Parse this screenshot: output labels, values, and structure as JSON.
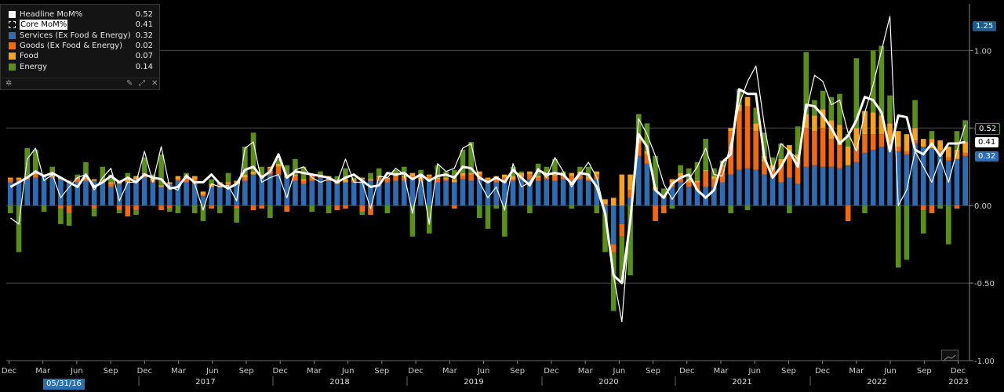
{
  "legend": {
    "items": [
      {
        "name": "Headline MoM%",
        "value": "0.52",
        "color": "#ffffff",
        "style": "filled"
      },
      {
        "name": "Core MoM%",
        "value": "0.41",
        "color": "#ffffff",
        "style": "outline"
      },
      {
        "name": "Services (Ex Food & Energy)",
        "value": "0.32",
        "color": "#2e6db4",
        "style": "filled"
      },
      {
        "name": "Goods (Ex Food & Energy)",
        "value": "0.02",
        "color": "#f26a10",
        "style": "filled"
      },
      {
        "name": "Food",
        "value": "0.07",
        "color": "#f7a21b",
        "style": "filled"
      },
      {
        "name": "Energy",
        "value": "0.14",
        "color": "#5a8f1a",
        "style": "filled"
      }
    ],
    "tools": {
      "settings_icon": "gear-icon",
      "pin_icon": "pin-icon",
      "expand_icon": "expand-icon",
      "close_icon": "close-icon"
    }
  },
  "cursor_date": "05/31/16",
  "right_tags": {
    "top": "1.25",
    "headline": "0.52",
    "core": "0.41",
    "services": "0.32"
  },
  "chart_data": {
    "type": "bar",
    "stacked": true,
    "ylim": [
      -1.0,
      1.3
    ],
    "yticks": [
      "1.00",
      "0.50",
      "0.00",
      "-0.50",
      "-1.00"
    ],
    "ytick_values": [
      1.0,
      0.5,
      0.0,
      -0.5,
      -1.0
    ],
    "x_months": [
      "Dec",
      "Mar",
      "Jun",
      "Sep",
      "Dec",
      "Mar",
      "Jun",
      "Sep",
      "Dec",
      "Mar",
      "Jun",
      "Sep",
      "Dec",
      "Mar",
      "Jun",
      "Sep",
      "Dec",
      "Mar",
      "Jun",
      "Sep",
      "Dec",
      "Mar",
      "Jun",
      "Sep",
      "Dec",
      "Mar",
      "Jun",
      "Sep",
      "Dec"
    ],
    "x_years": [
      {
        "label": "2017",
        "at": "Jun"
      },
      {
        "label": "2018",
        "at": "Jun"
      },
      {
        "label": "2019",
        "at": "Jun"
      },
      {
        "label": "2020",
        "at": "Jun"
      },
      {
        "label": "2021",
        "at": "Jun"
      },
      {
        "label": "2022",
        "at": "Jun"
      },
      {
        "label": "2023",
        "at": "Jan"
      }
    ],
    "start": "2016-02",
    "series": [
      {
        "name": "Services (Ex Food & Energy)",
        "color": "#2e6db4",
        "values": [
          0.15,
          0.16,
          0.17,
          0.18,
          0.19,
          0.18,
          0.17,
          0.16,
          0.15,
          0.16,
          0.16,
          0.15,
          0.12,
          0.14,
          0.15,
          0.17,
          0.18,
          0.15,
          0.12,
          0.14,
          0.16,
          0.15,
          0.14,
          0.06,
          0.12,
          0.12,
          0.13,
          0.14,
          0.16,
          0.2,
          0.18,
          0.2,
          0.2,
          0.18,
          0.16,
          0.14,
          0.16,
          0.18,
          0.16,
          0.14,
          0.15,
          0.15,
          0.17,
          0.16,
          0.16,
          0.15,
          0.16,
          0.16,
          0.17,
          0.16,
          0.16,
          0.15,
          0.16,
          0.15,
          0.17,
          0.16,
          0.17,
          0.16,
          0.15,
          0.16,
          0.16,
          0.17,
          0.17,
          0.16,
          0.17,
          0.16,
          0.17,
          0.16,
          0.17,
          0.16,
          0.17,
          -0.05,
          -0.25,
          -0.12,
          0.05,
          0.32,
          0.27,
          0.1,
          0.05,
          0.12,
          0.15,
          0.12,
          0.1,
          0.12,
          0.12,
          0.15,
          0.2,
          0.23,
          0.24,
          0.23,
          0.2,
          0.18,
          0.15,
          0.18,
          0.14,
          0.25,
          0.26,
          0.25,
          0.25,
          0.24,
          0.26,
          0.28,
          0.34,
          0.36,
          0.38,
          0.36,
          0.35,
          0.33,
          0.4,
          0.38,
          0.37,
          0.33,
          0.29,
          0.3,
          0.32
        ],
        "note": "values in percentage points"
      },
      {
        "name": "Goods (Ex Food & Energy)",
        "color": "#f26a10",
        "values": [
          0.02,
          0.01,
          0.01,
          0.02,
          0.01,
          0.01,
          -0.02,
          -0.05,
          0.02,
          0.01,
          -0.02,
          0.01,
          0.02,
          -0.03,
          -0.07,
          -0.03,
          0.02,
          0.01,
          -0.03,
          -0.02,
          0.01,
          0.02,
          0.03,
          0.01,
          -0.02,
          0.02,
          0.01,
          -0.02,
          0.02,
          -0.03,
          -0.02,
          0.04,
          0.05,
          -0.04,
          0.03,
          0.02,
          0.03,
          0.01,
          0.02,
          -0.03,
          -0.02,
          0.01,
          -0.04,
          -0.06,
          0.02,
          0.02,
          0.03,
          0.02,
          0.02,
          0.01,
          0.03,
          0.02,
          0.01,
          -0.02,
          0.02,
          0.04,
          0.03,
          0.01,
          0.03,
          0.02,
          0.01,
          0.02,
          0.03,
          0.02,
          0.02,
          0.03,
          0.02,
          0.03,
          0.03,
          0.01,
          0.03,
          0.01,
          -0.05,
          -0.08,
          0.05,
          0.08,
          0.06,
          -0.1,
          -0.05,
          0.03,
          0.04,
          0.03,
          0.05,
          0.1,
          0.05,
          0.1,
          0.28,
          0.38,
          0.4,
          0.25,
          0.08,
          0.05,
          0.1,
          0.15,
          0.12,
          0.25,
          0.22,
          0.25,
          0.18,
          0.15,
          -0.1,
          0.08,
          0.12,
          0.1,
          0.08,
          0.05,
          0.03,
          0.02,
          0.02,
          -0.03,
          -0.05,
          0.03,
          0.02,
          -0.02,
          0.02
        ],
        "note": "values in percentage points"
      },
      {
        "name": "Food",
        "color": "#f7a21b",
        "values": [
          0.01,
          0.01,
          0.01,
          0.01,
          0.0,
          0.0,
          0.01,
          0.0,
          0.01,
          0.01,
          0.01,
          0.01,
          0.01,
          0.02,
          0.02,
          0.02,
          0.01,
          0.02,
          0.01,
          0.01,
          0.02,
          0.02,
          0.02,
          0.02,
          0.02,
          0.01,
          0.01,
          0.02,
          0.02,
          0.02,
          0.02,
          0.01,
          0.02,
          0.02,
          0.01,
          0.01,
          0.01,
          0.01,
          0.01,
          0.02,
          0.02,
          0.01,
          0.01,
          0.01,
          0.01,
          0.01,
          0.01,
          0.01,
          0.02,
          0.02,
          0.01,
          0.01,
          0.01,
          0.02,
          0.02,
          0.01,
          0.02,
          0.01,
          0.01,
          0.02,
          0.02,
          0.02,
          0.02,
          0.01,
          0.02,
          0.01,
          0.01,
          0.02,
          0.02,
          0.02,
          0.02,
          0.03,
          0.05,
          0.2,
          0.1,
          0.04,
          0.02,
          0.02,
          0.01,
          0.02,
          0.02,
          0.02,
          0.01,
          0.01,
          0.02,
          0.01,
          0.02,
          0.04,
          0.06,
          0.05,
          0.04,
          0.03,
          0.05,
          0.06,
          0.07,
          0.09,
          0.1,
          0.12,
          0.12,
          0.13,
          0.12,
          0.14,
          0.15,
          0.14,
          0.12,
          0.12,
          0.1,
          0.11,
          0.08,
          0.05,
          0.06,
          0.06,
          0.07,
          0.06,
          0.07
        ]
      },
      {
        "name": "Energy",
        "color": "#5a8f1a",
        "values": [
          -0.05,
          -0.3,
          0.18,
          0.15,
          -0.04,
          0.06,
          -0.1,
          -0.08,
          0.02,
          0.1,
          -0.05,
          0.08,
          0.05,
          -0.02,
          0.04,
          -0.03,
          0.1,
          0.02,
          0.2,
          -0.02,
          -0.05,
          0.02,
          -0.05,
          -0.1,
          0.03,
          -0.05,
          0.06,
          -0.09,
          0.18,
          0.25,
          0.05,
          -0.08,
          0.03,
          0.06,
          0.1,
          0.08,
          -0.04,
          0.02,
          -0.05,
          0.03,
          0.07,
          0.01,
          -0.02,
          0.04,
          0.05,
          -0.05,
          0.03,
          0.06,
          -0.2,
          0.04,
          -0.18,
          0.08,
          0.04,
          0.06,
          0.15,
          0.2,
          -0.08,
          -0.15,
          -0.02,
          -0.2,
          0.06,
          0.01,
          -0.05,
          0.08,
          0.04,
          0.1,
          0.02,
          -0.02,
          0.03,
          0.06,
          -0.05,
          -0.25,
          -0.38,
          -0.3,
          -0.45,
          0.15,
          0.18,
          0.2,
          0.05,
          -0.02,
          0.05,
          0.07,
          0.12,
          0.2,
          0.05,
          0.03,
          -0.05,
          0.1,
          -0.03,
          0.1,
          0.15,
          0.05,
          0.1,
          -0.05,
          0.18,
          0.4,
          0.1,
          0.12,
          0.15,
          0.2,
          0.08,
          0.45,
          -0.05,
          0.4,
          0.45,
          0.18,
          -0.4,
          -0.35,
          0.18,
          -0.15,
          0.05,
          -0.02,
          -0.25,
          0.12,
          0.14
        ]
      },
      {
        "name": "Headline MoM%",
        "type": "line",
        "color": "#ffffff",
        "width": 1.2,
        "values": [
          -0.08,
          -0.12,
          0.3,
          0.37,
          0.16,
          0.2,
          0.05,
          0.12,
          0.18,
          0.2,
          0.1,
          0.18,
          0.24,
          0.03,
          0.15,
          0.15,
          0.35,
          0.15,
          0.38,
          0.12,
          0.1,
          0.2,
          0.14,
          -0.03,
          0.14,
          0.12,
          0.13,
          0.03,
          0.37,
          0.41,
          0.15,
          0.18,
          0.2,
          0.05,
          0.23,
          0.25,
          0.18,
          0.15,
          0.17,
          0.15,
          0.3,
          0.15,
          0.15,
          -0.02,
          0.19,
          0.18,
          0.24,
          0.2,
          -0.05,
          0.2,
          -0.12,
          0.27,
          0.22,
          0.24,
          0.37,
          0.4,
          0.15,
          0.05,
          0.12,
          -0.03,
          0.27,
          0.12,
          0.15,
          0.24,
          0.18,
          0.31,
          0.22,
          0.12,
          0.2,
          0.28,
          0.18,
          -0.05,
          -0.45,
          -0.75,
          -0.06,
          0.56,
          0.46,
          0.32,
          0.14,
          0.04,
          0.12,
          0.17,
          0.25,
          0.37,
          0.2,
          0.19,
          0.4,
          0.65,
          0.8,
          0.9,
          0.52,
          0.22,
          0.4,
          0.35,
          0.3,
          0.6,
          0.84,
          0.8,
          0.65,
          0.68,
          0.47,
          0.35,
          0.6,
          0.78,
          1.0,
          1.22,
          0.0,
          0.1,
          0.35,
          0.25,
          0.15,
          0.3,
          0.15,
          0.35,
          0.52
        ]
      },
      {
        "name": "Core MoM%",
        "type": "line",
        "color": "#ffffff",
        "width": 3,
        "values": [
          0.12,
          0.15,
          0.18,
          0.22,
          0.19,
          0.21,
          0.18,
          0.15,
          0.12,
          0.2,
          0.12,
          0.15,
          0.19,
          0.15,
          0.18,
          0.15,
          0.2,
          0.18,
          0.17,
          0.11,
          0.12,
          0.19,
          0.15,
          0.15,
          0.2,
          0.14,
          0.11,
          0.14,
          0.23,
          0.25,
          0.18,
          0.22,
          0.33,
          0.18,
          0.22,
          0.21,
          0.2,
          0.19,
          0.18,
          0.15,
          0.18,
          0.2,
          0.16,
          0.12,
          0.13,
          0.21,
          0.2,
          0.21,
          0.17,
          0.2,
          0.16,
          0.19,
          0.2,
          0.18,
          0.25,
          0.24,
          0.18,
          0.15,
          0.18,
          0.15,
          0.23,
          0.18,
          0.13,
          0.23,
          0.2,
          0.21,
          0.2,
          0.14,
          0.21,
          0.2,
          0.12,
          -0.05,
          -0.45,
          -0.5,
          -0.1,
          0.46,
          0.38,
          0.1,
          0.05,
          0.14,
          0.18,
          0.2,
          0.1,
          0.05,
          0.1,
          0.28,
          0.33,
          0.75,
          0.72,
          0.72,
          0.31,
          0.18,
          0.25,
          0.35,
          0.25,
          0.65,
          0.64,
          0.58,
          0.5,
          0.4,
          0.45,
          0.55,
          0.7,
          0.68,
          0.6,
          0.35,
          0.58,
          0.57,
          0.36,
          0.33,
          0.4,
          0.32,
          0.4,
          0.4,
          0.41
        ]
      }
    ]
  }
}
